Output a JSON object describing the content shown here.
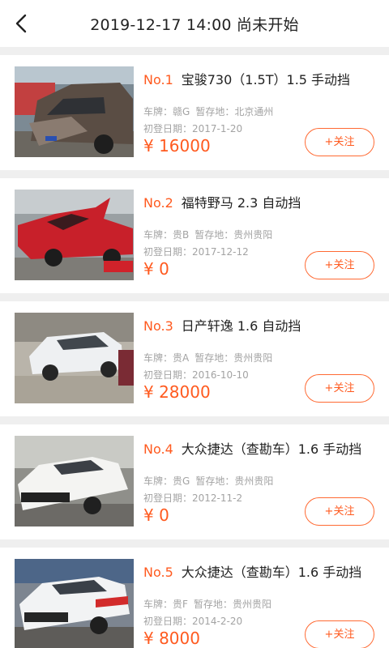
{
  "header": {
    "title": "2019-12-17 14:00 尚未开始"
  },
  "labels": {
    "plate": "车牌：",
    "storage": "暂存地：",
    "reg_date": "初登日期："
  },
  "cars": [
    {
      "no": "No.1",
      "name": "宝骏730（1.5T）1.5 手动挡",
      "plate": "赣G",
      "storage": "北京通州",
      "reg_date": "2017-1-20",
      "price": "¥ 16000",
      "follow": "+关注"
    },
    {
      "no": "No.2",
      "name": "福特野马 2.3 自动挡",
      "plate": "贵B",
      "storage": "贵州贵阳",
      "reg_date": "2017-12-12",
      "price": "¥ 0",
      "follow": "+关注"
    },
    {
      "no": "No.3",
      "name": "日产轩逸 1.6 自动挡",
      "plate": "贵A",
      "storage": "贵州贵阳",
      "reg_date": "2016-10-10",
      "price": "¥ 28000",
      "follow": "+关注"
    },
    {
      "no": "No.4",
      "name": "大众捷达（查勘车）1.6 手动挡",
      "plate": "贵G",
      "storage": "贵州贵阳",
      "reg_date": "2012-11-2",
      "price": "¥ 0",
      "follow": "+关注"
    },
    {
      "no": "No.5",
      "name": "大众捷达（查勘车）1.6 手动挡",
      "plate": "贵F",
      "storage": "贵州贵阳",
      "reg_date": "2014-2-20",
      "price": "¥ 8000",
      "follow": "+关注"
    }
  ],
  "colors": {
    "accent": "#ff5a1f",
    "meta_text": "#a3a3a3",
    "background": "#efefef"
  }
}
